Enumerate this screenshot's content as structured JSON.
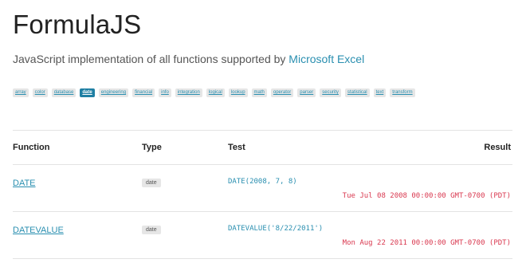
{
  "header": {
    "title": "FormulaJS",
    "subtitle_prefix": "JavaScript implementation of all functions supported by ",
    "subtitle_link": "Microsoft Excel"
  },
  "tags": [
    "array",
    "color",
    "database",
    "date",
    "engineering",
    "financial",
    "info",
    "integration",
    "logical",
    "lookup",
    "math",
    "operator",
    "parser",
    "security",
    "statistical",
    "text",
    "transform"
  ],
  "active_tag": "date",
  "table": {
    "headers": {
      "function": "Function",
      "type": "Type",
      "test": "Test",
      "result": "Result"
    },
    "rows": [
      {
        "function": "DATE",
        "type": "date",
        "test": "DATE(2008, 7, 8)",
        "result": "Tue Jul 08 2008 00:00:00 GMT-0700 (PDT)"
      },
      {
        "function": "DATEVALUE",
        "type": "date",
        "test": "DATEVALUE('8/22/2011')",
        "result": "Mon Aug 22 2011 00:00:00 GMT-0700 (PDT)"
      }
    ]
  },
  "colors": {
    "link": "#2a8fb0",
    "active_tag_bg": "#1f7fa3",
    "result": "#d9384f"
  }
}
